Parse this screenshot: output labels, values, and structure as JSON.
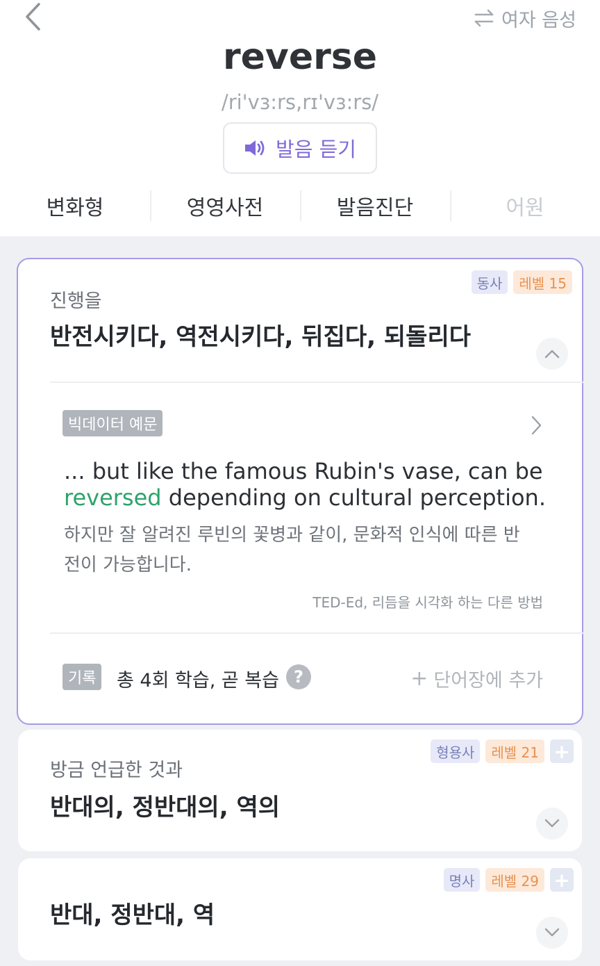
{
  "header": {
    "word": "reverse",
    "phonetic": "/ri'vɜ:rs,rɪ'vɜ:rs/",
    "voice_toggle": "여자 음성",
    "listen_label": "발음 듣기"
  },
  "tabs": [
    {
      "label": "변화형",
      "enabled": true
    },
    {
      "label": "영영사전",
      "enabled": true
    },
    {
      "label": "발음진단",
      "enabled": true
    },
    {
      "label": "어원",
      "enabled": false
    }
  ],
  "senses": [
    {
      "pos": "동사",
      "level": "레벨 15",
      "context": "진행을",
      "meaning": "반전시키다, 역전시키다, 뒤집다, 되돌리다",
      "expanded": true,
      "example": {
        "tag": "빅데이터 예문",
        "en_pre": "... but like the famous Rubin's vase, can be",
        "en_highlight": "reversed",
        "en_post": "depending on cultural perception.",
        "ko_line1": "하지만 잘 알려진 루빈의 꽃병과 같이, 문화적 인식에 따른 반",
        "ko_line2": "전이 가능합니다.",
        "source": "TED-Ed, 리듬을 시각화 하는 다른 방법"
      },
      "record": {
        "tag": "기록",
        "text": "총 4회 학습, 곧 복습",
        "help": "?",
        "add_label": "단어장에 추가"
      }
    },
    {
      "pos": "형용사",
      "level": "레벨 21",
      "context": "방금 언급한 것과",
      "meaning": "반대의, 정반대의, 역의",
      "expanded": false
    },
    {
      "pos": "명사",
      "level": "레벨 29",
      "context": "",
      "meaning": "반대, 정반대, 역",
      "expanded": false
    }
  ],
  "colors": {
    "accent": "#7f6ad8",
    "highlight": "#2ea36b",
    "level_badge": "#e8914f",
    "card_border": "#a59be6"
  }
}
